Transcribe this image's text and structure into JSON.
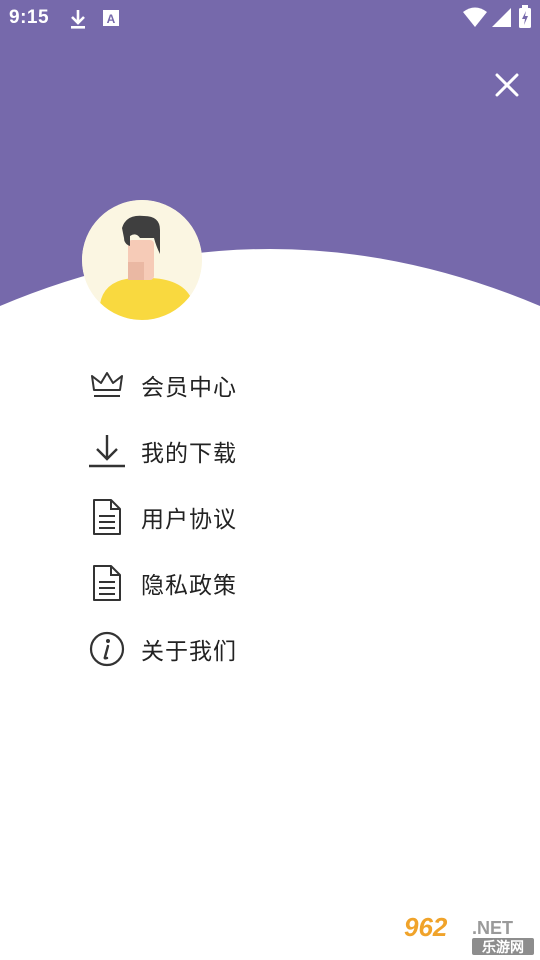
{
  "status_bar": {
    "time": "9:15",
    "left_icons": [
      "download-icon",
      "text-a-icon"
    ],
    "right_icons": [
      "wifi-icon",
      "signal-icon",
      "battery-icon"
    ]
  },
  "header": {
    "background_color": "#7669ab",
    "close_icon": "close-icon"
  },
  "profile": {
    "avatar_icon": "user-avatar"
  },
  "menu": {
    "items": [
      {
        "label": "会员中心",
        "icon": "crown-icon"
      },
      {
        "label": "我的下载",
        "icon": "download-icon"
      },
      {
        "label": "用户协议",
        "icon": "document-icon"
      },
      {
        "label": "隐私政策",
        "icon": "document-icon"
      },
      {
        "label": "关于我们",
        "icon": "info-icon"
      }
    ]
  },
  "watermark": {
    "logo_text": "962.NET",
    "sub_text": "乐游网"
  }
}
